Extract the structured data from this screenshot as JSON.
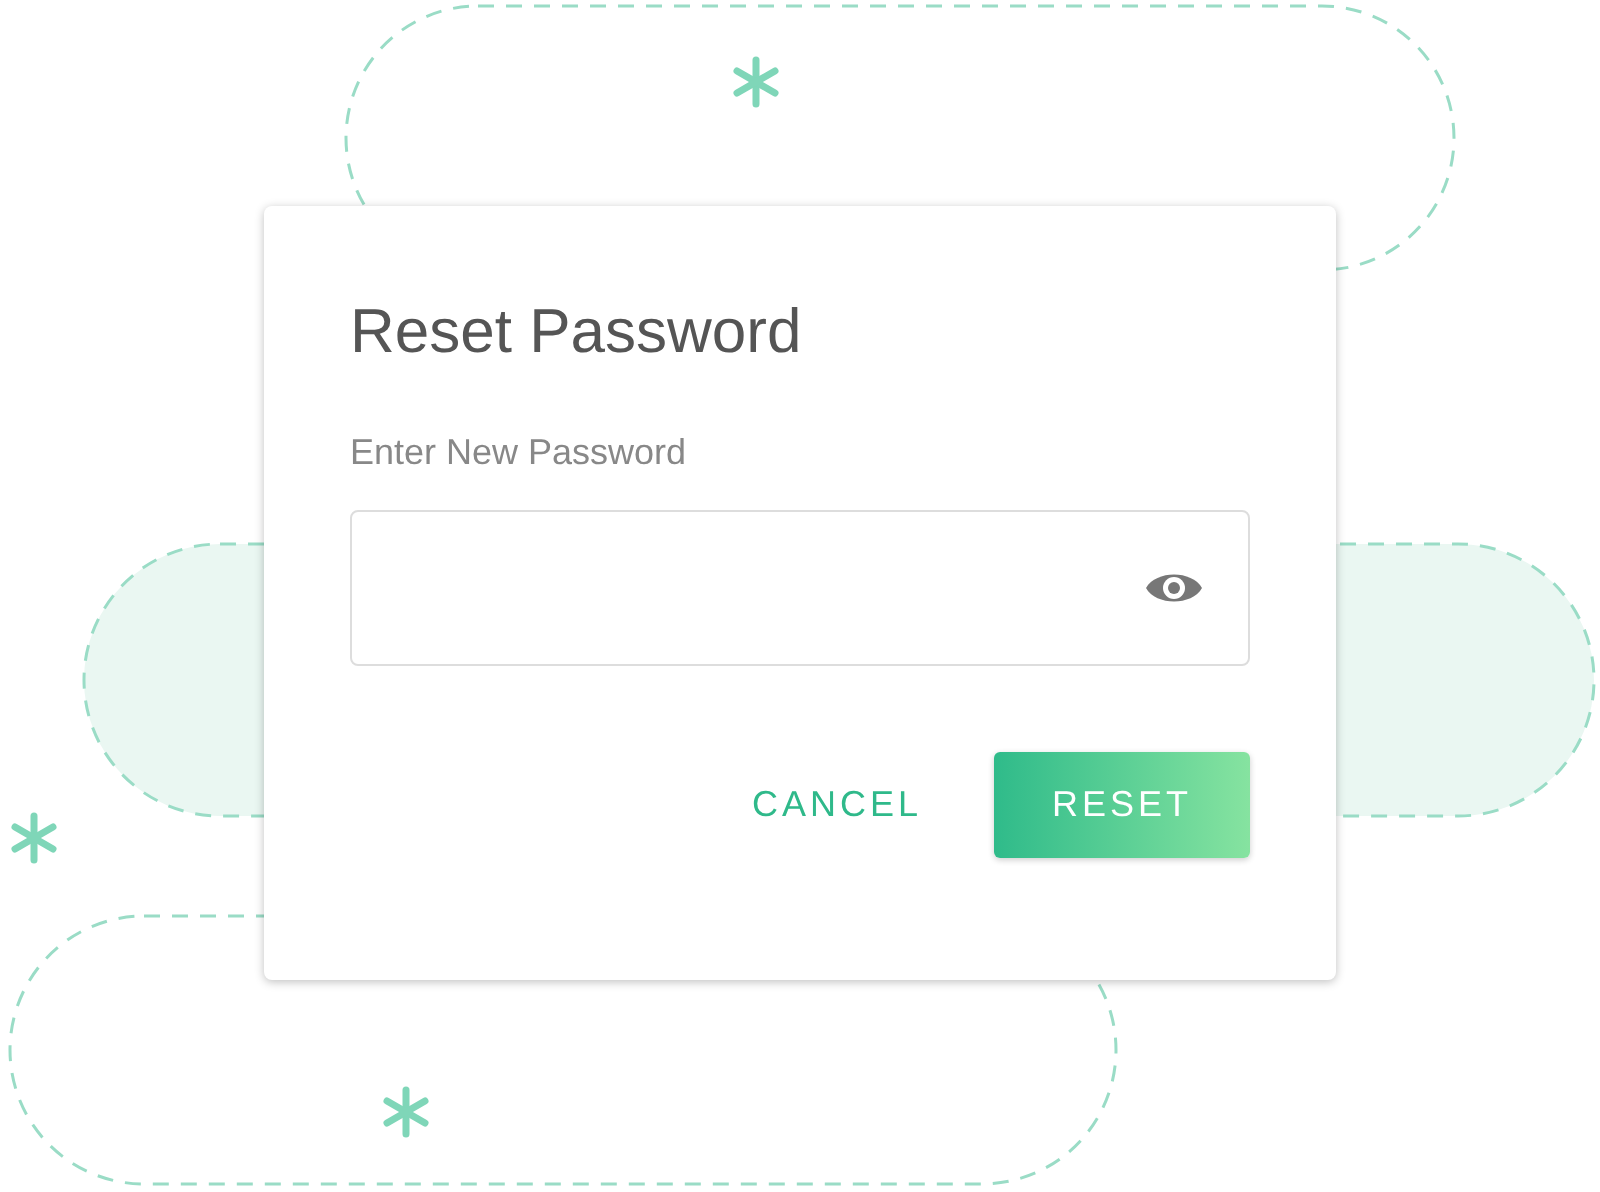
{
  "dialog": {
    "title": "Reset Password",
    "field": {
      "label": "Enter New Password"
    },
    "buttons": [
      {
        "label": "CANCEL",
        "kind": "text"
      },
      {
        "label": "RESET",
        "kind": "primary"
      }
    ]
  }
}
